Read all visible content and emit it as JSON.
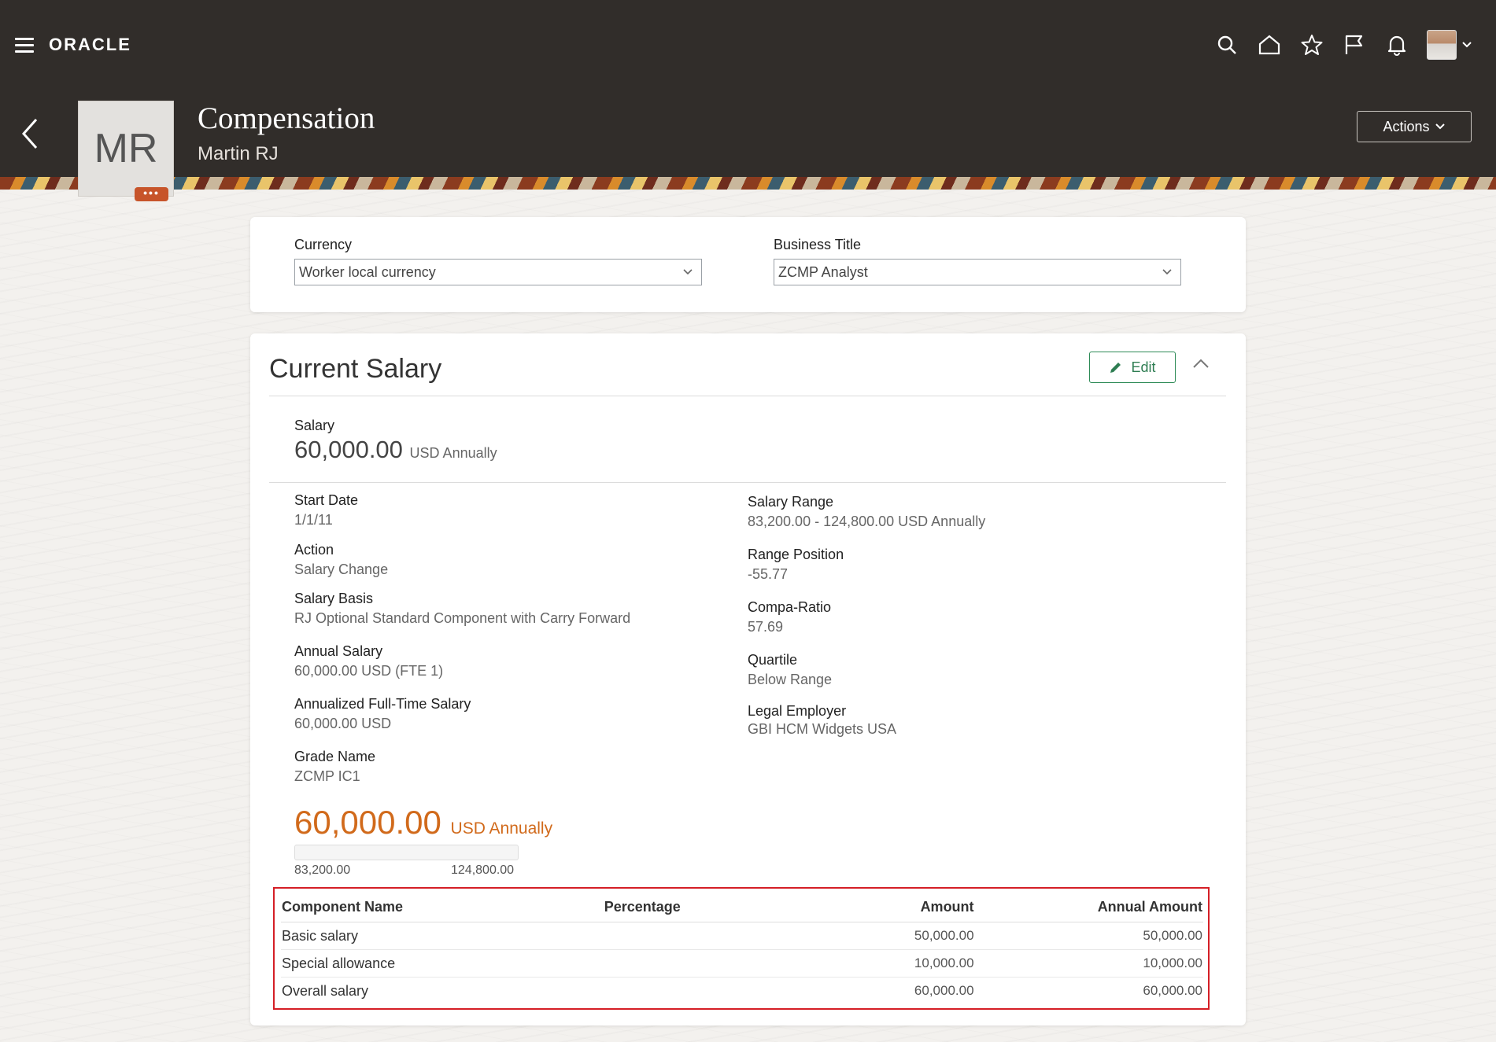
{
  "header": {
    "brand": "ORACLE",
    "title": "Compensation",
    "person_name": "Martin RJ",
    "initials": "MR",
    "actions_label": "Actions"
  },
  "filters": {
    "currency_label": "Currency",
    "currency_value": "Worker local currency",
    "business_title_label": "Business Title",
    "business_title_value": "ZCMP Analyst"
  },
  "current_salary": {
    "section_title": "Current Salary",
    "edit_label": "Edit",
    "salary_label": "Salary",
    "salary_amount": "60,000.00",
    "salary_unit": "USD Annually",
    "left_fields": [
      {
        "label": "Start Date",
        "value": "1/1/11"
      },
      {
        "label": "Action",
        "value": "Salary Change"
      },
      {
        "label": "Salary Basis",
        "value": "RJ Optional Standard Component with Carry Forward"
      },
      {
        "label": "Annual Salary",
        "value": "60,000.00 USD (FTE 1)"
      },
      {
        "label": "Annualized Full-Time Salary",
        "value": "60,000.00 USD"
      },
      {
        "label": "Grade Name",
        "value": "ZCMP IC1"
      }
    ],
    "right_fields": [
      {
        "label": "Salary Range",
        "value": "83,200.00 - 124,800.00 USD Annually"
      },
      {
        "label": "Range Position",
        "value": "-55.77"
      },
      {
        "label": "Compa-Ratio",
        "value": "57.69"
      },
      {
        "label": "Quartile",
        "value": "Below Range"
      },
      {
        "label": "Legal Employer",
        "value": "GBI HCM Widgets USA"
      }
    ],
    "range_amount": "60,000.00",
    "range_unit": "USD Annually",
    "range_min": "83,200.00",
    "range_max": "124,800.00"
  },
  "components_table": {
    "headers": [
      "Component Name",
      "Percentage",
      "Amount",
      "Annual Amount"
    ],
    "rows": [
      {
        "name": "Basic salary",
        "percentage": "",
        "amount": "50,000.00",
        "annual": "50,000.00"
      },
      {
        "name": "Special allowance",
        "percentage": "",
        "amount": "10,000.00",
        "annual": "10,000.00"
      },
      {
        "name": "Overall salary",
        "percentage": "",
        "amount": "60,000.00",
        "annual": "60,000.00"
      }
    ]
  },
  "icons": {
    "menu": "hamburger-icon",
    "search": "search-icon",
    "home": "home-icon",
    "favorites": "star-icon",
    "watchlist": "flag-icon",
    "notifications": "bell-icon",
    "back": "back-icon",
    "edit": "pencil-icon",
    "collapse": "chevron-up-icon"
  },
  "colors": {
    "header_bg": "#312d2a",
    "accent_orange": "#d16a1b",
    "edit_green": "#2e7d52",
    "highlight_red": "#d51f26"
  }
}
